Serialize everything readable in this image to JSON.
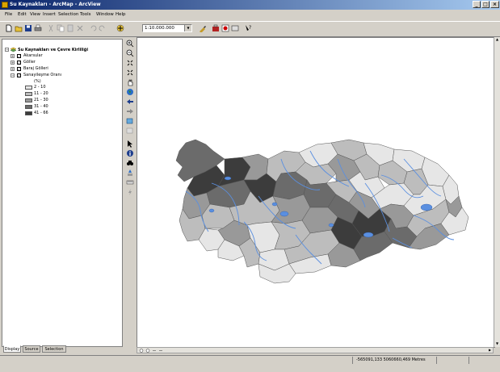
{
  "window": {
    "title": "Su Kaynakları - ArcMap - ArcView",
    "minimize": "_",
    "maximize": "□",
    "close": "×"
  },
  "menubar": {
    "items": [
      "File",
      "Edit",
      "View",
      "Insert",
      "Selection",
      "Tools",
      "Window",
      "Help"
    ]
  },
  "toolbar": {
    "scale_value": "1:10.000.000"
  },
  "toc": {
    "root_label": "Su Kaynakları ve Çevre Kirliliği",
    "layers": [
      {
        "label": "Akarsular",
        "checked": true
      },
      {
        "label": "Göller",
        "checked": true
      },
      {
        "label": "Baraj Gölleri",
        "checked": true
      },
      {
        "label": "Sanayileşme Oranı",
        "checked": true
      }
    ],
    "legend_heading": "(%)",
    "legend": [
      {
        "label": "2 - 10",
        "color": "#e6e6e6"
      },
      {
        "label": "11 - 20",
        "color": "#bdbdbd"
      },
      {
        "label": "21 - 30",
        "color": "#999999"
      },
      {
        "label": "31 - 40",
        "color": "#6b6b6b"
      },
      {
        "label": "41 - 66",
        "color": "#3c3c3c"
      }
    ],
    "tabs": [
      "Display",
      "Source",
      "Selection"
    ]
  },
  "status": {
    "coordinates": "-565091,133  5060660,469 Metres"
  },
  "colors": {
    "title_start": "#0a246a",
    "title_end": "#a6caf0",
    "chrome": "#d4d0c8",
    "water": "#5a8fe0"
  }
}
